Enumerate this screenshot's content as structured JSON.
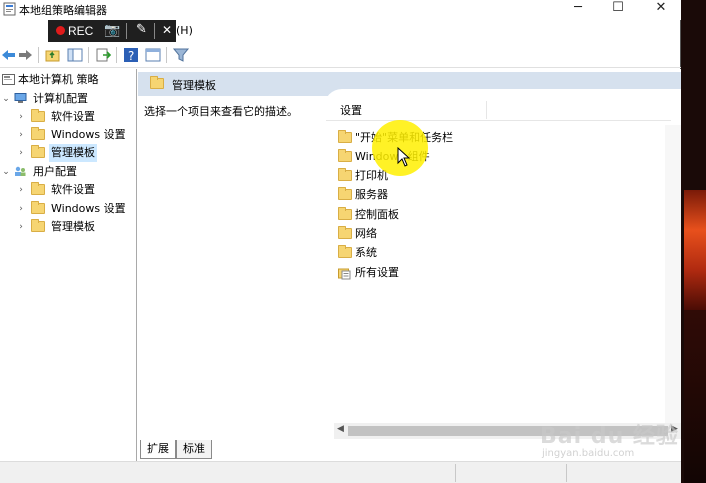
{
  "window": {
    "title": "本地组策略编辑器"
  },
  "recorder": {
    "label": "REC"
  },
  "menu": {
    "help_partial": "(H)"
  },
  "tree": {
    "root": "本地计算机 策略",
    "computer_config": "计算机配置",
    "computer_children": [
      "软件设置",
      "Windows 设置",
      "管理模板"
    ],
    "user_config": "用户配置",
    "user_children": [
      "软件设置",
      "Windows 设置",
      "管理模板"
    ]
  },
  "main": {
    "header_title": "管理模板",
    "description": "选择一个项目来查看它的描述。",
    "column_header": "设置",
    "items": [
      "\"开始\"菜单和任务栏",
      "Windows 组件",
      "打印机",
      "服务器",
      "控制面板",
      "网络",
      "系统",
      "所有设置"
    ]
  },
  "tabs": [
    "扩展",
    "标准"
  ],
  "watermark": {
    "text": "Bai du 经验",
    "sub": "jingyan.baidu.com"
  },
  "colors": {
    "selection": "#cce8ff",
    "header_band": "#d6e1ee",
    "folder": "#f6d572",
    "highlight": "#fff000"
  }
}
